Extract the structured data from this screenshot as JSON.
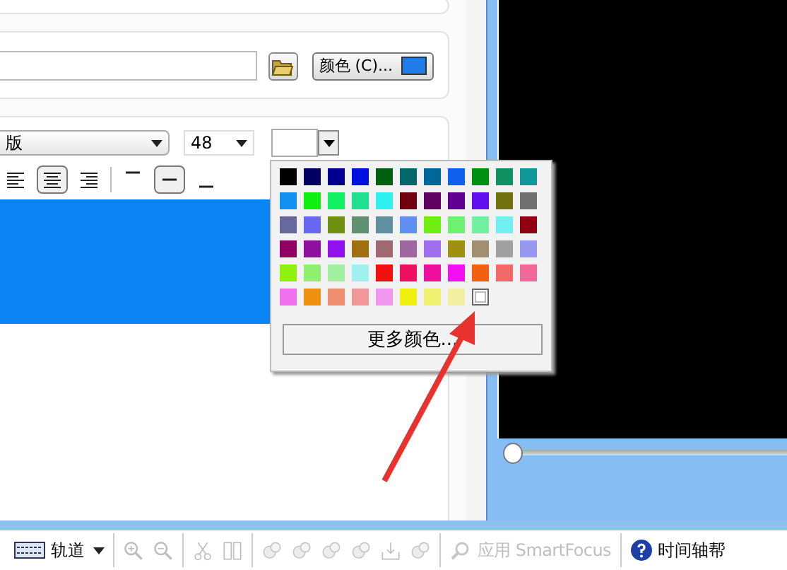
{
  "file_row": {
    "color_button": {
      "label": "颜色 (C)...",
      "color": "#1e7be8"
    }
  },
  "font_row": {
    "font": "版",
    "size": "48",
    "text_color_swatch": {
      "color": "#ffffff"
    }
  },
  "align_buttons": [
    {
      "kind": "left",
      "selected": false
    },
    {
      "kind": "center",
      "selected": true
    },
    {
      "kind": "right",
      "selected": false
    },
    {
      "kind": "top",
      "selected": false
    },
    {
      "kind": "middle",
      "selected": true
    },
    {
      "kind": "bottom",
      "selected": false
    }
  ],
  "text_area": {
    "color": "#0a84f5"
  },
  "palette": {
    "colors": [
      {
        "color": "#000000",
        "selected": false
      },
      {
        "color": "#000060",
        "selected": false
      },
      {
        "color": "#000090",
        "selected": false
      },
      {
        "color": "#0010e0",
        "selected": false
      },
      {
        "color": "#006010",
        "selected": false
      },
      {
        "color": "#006868",
        "selected": false
      },
      {
        "color": "#006898",
        "selected": false
      },
      {
        "color": "#1060f0",
        "selected": false
      },
      {
        "color": "#009010",
        "selected": false
      },
      {
        "color": "#109060",
        "selected": false
      },
      {
        "color": "#109898",
        "selected": false
      },
      {
        "color": "#1090f0",
        "selected": false
      },
      {
        "color": "#10f010",
        "selected": false
      },
      {
        "color": "#10f060",
        "selected": false
      },
      {
        "color": "#20e090",
        "selected": false
      },
      {
        "color": "#30f0f0",
        "selected": false
      },
      {
        "color": "#700010",
        "selected": false
      },
      {
        "color": "#600060",
        "selected": false
      },
      {
        "color": "#600090",
        "selected": false
      },
      {
        "color": "#6010f0",
        "selected": false
      },
      {
        "color": "#707010",
        "selected": false
      },
      {
        "color": "#707070",
        "selected": false
      },
      {
        "color": "#6868a0",
        "selected": false
      },
      {
        "color": "#6868f0",
        "selected": false
      },
      {
        "color": "#709010",
        "selected": false
      },
      {
        "color": "#609070",
        "selected": false
      },
      {
        "color": "#6090a0",
        "selected": false
      },
      {
        "color": "#6090f0",
        "selected": false
      },
      {
        "color": "#70f010",
        "selected": false
      },
      {
        "color": "#70f070",
        "selected": false
      },
      {
        "color": "#70f0a0",
        "selected": false
      },
      {
        "color": "#70f0f0",
        "selected": false
      },
      {
        "color": "#900010",
        "selected": false
      },
      {
        "color": "#900060",
        "selected": false
      },
      {
        "color": "#9010a0",
        "selected": false
      },
      {
        "color": "#9010f0",
        "selected": false
      },
      {
        "color": "#a07010",
        "selected": false
      },
      {
        "color": "#a06870",
        "selected": false
      },
      {
        "color": "#a068a0",
        "selected": false
      },
      {
        "color": "#a070f0",
        "selected": false
      },
      {
        "color": "#a09010",
        "selected": false
      },
      {
        "color": "#a09070",
        "selected": false
      },
      {
        "color": "#a0a0a0",
        "selected": false
      },
      {
        "color": "#9898f0",
        "selected": false
      },
      {
        "color": "#90f010",
        "selected": false
      },
      {
        "color": "#90f070",
        "selected": false
      },
      {
        "color": "#a0f0a0",
        "selected": false
      },
      {
        "color": "#a0f0f0",
        "selected": false
      },
      {
        "color": "#f01010",
        "selected": false
      },
      {
        "color": "#f01060",
        "selected": false
      },
      {
        "color": "#f010a0",
        "selected": false
      },
      {
        "color": "#f010f0",
        "selected": false
      },
      {
        "color": "#f06010",
        "selected": false
      },
      {
        "color": "#f06868",
        "selected": false
      },
      {
        "color": "#f06898",
        "selected": false
      },
      {
        "color": "#f070f0",
        "selected": false
      },
      {
        "color": "#f09010",
        "selected": false
      },
      {
        "color": "#f09070",
        "selected": false
      },
      {
        "color": "#f09898",
        "selected": false
      },
      {
        "color": "#f098f0",
        "selected": false
      },
      {
        "color": "#f0f010",
        "selected": false
      },
      {
        "color": "#f0f070",
        "selected": false
      },
      {
        "color": "#f0f0a0",
        "selected": false
      },
      {
        "color": "#ffffff",
        "selected": true
      }
    ],
    "more_button": "更多颜色..."
  },
  "preview": {
    "position": {
      "level": 0
    }
  },
  "toolbar": {
    "track_button": "轨道",
    "tools": [
      {
        "kind": "zoom-in",
        "disabled": true
      },
      {
        "kind": "zoom-out",
        "disabled": true
      },
      {
        "kind": "cut",
        "disabled": true
      },
      {
        "kind": "split",
        "disabled": true
      },
      {
        "kind": "clip",
        "disabled": true
      },
      {
        "kind": "clip",
        "disabled": true
      },
      {
        "kind": "clip",
        "disabled": true
      },
      {
        "kind": "clip",
        "disabled": true
      },
      {
        "kind": "export",
        "disabled": true
      },
      {
        "kind": "clip",
        "disabled": true
      }
    ],
    "smartfocus": {
      "label": "应用 SmartFocus",
      "disabled": true
    },
    "help": "时间轴帮"
  }
}
